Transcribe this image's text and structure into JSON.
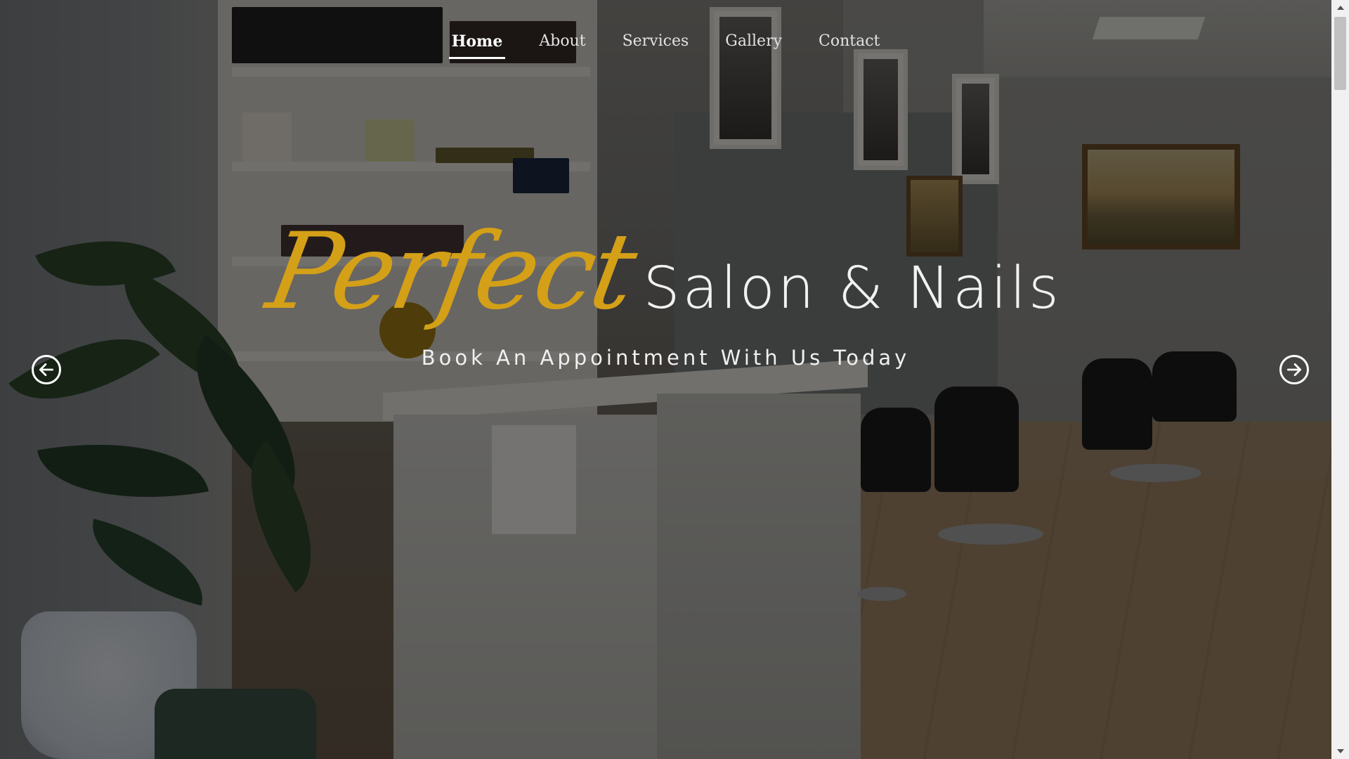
{
  "nav": {
    "items": [
      {
        "label": "Home",
        "active": true
      },
      {
        "label": "About",
        "active": false
      },
      {
        "label": "Services",
        "active": false
      },
      {
        "label": "Gallery",
        "active": false
      },
      {
        "label": "Contact",
        "active": false
      }
    ]
  },
  "hero": {
    "brand_script": "Perfect",
    "brand_rest": "Salon & Nails",
    "subtitle": "Book An Appointment With Us Today",
    "prev_icon": "arrow-left-circle-icon",
    "next_icon": "arrow-right-circle-icon"
  },
  "colors": {
    "brand_gold": "#d4a017",
    "text_light": "#f2f2f2",
    "overlay": "rgba(0,0,0,0.52)"
  },
  "scrollbar": {
    "up_icon": "scroll-up-arrow-icon",
    "down_icon": "scroll-down-arrow-icon"
  }
}
